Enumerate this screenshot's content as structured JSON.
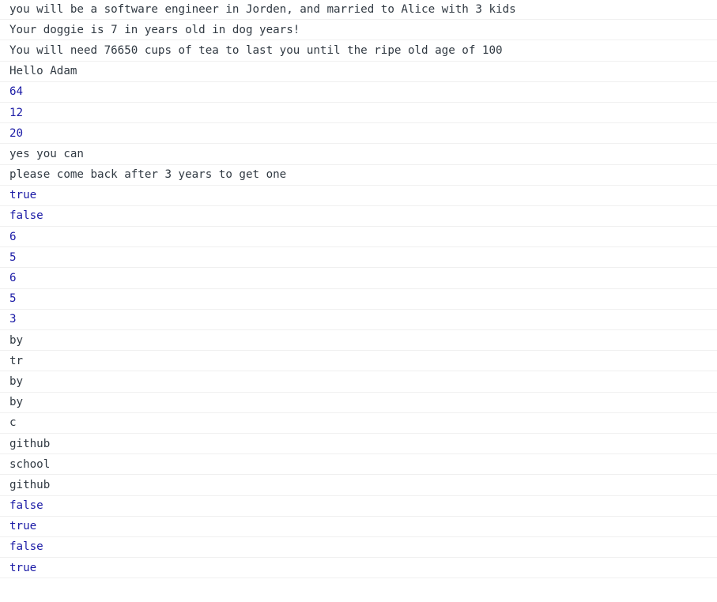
{
  "console": {
    "lines": [
      {
        "text": "you will be a software engineer in Jorden, and married to Alice with 3 kids",
        "type": "string"
      },
      {
        "text": "Your doggie is 7 in years old in dog years!",
        "type": "string"
      },
      {
        "text": "You will need 76650 cups of tea to last you until the ripe old age of 100",
        "type": "string"
      },
      {
        "text": "Hello Adam",
        "type": "string"
      },
      {
        "text": "64",
        "type": "number"
      },
      {
        "text": "12",
        "type": "number"
      },
      {
        "text": "20",
        "type": "number"
      },
      {
        "text": "yes you can",
        "type": "string"
      },
      {
        "text": "please come back after 3 years to get one",
        "type": "string"
      },
      {
        "text": "true",
        "type": "boolean"
      },
      {
        "text": "false",
        "type": "boolean"
      },
      {
        "text": "6",
        "type": "number"
      },
      {
        "text": "5",
        "type": "number"
      },
      {
        "text": "6",
        "type": "number"
      },
      {
        "text": "5",
        "type": "number"
      },
      {
        "text": "3",
        "type": "number"
      },
      {
        "text": "by",
        "type": "string"
      },
      {
        "text": "tr",
        "type": "string"
      },
      {
        "text": "by",
        "type": "string"
      },
      {
        "text": "by",
        "type": "string"
      },
      {
        "text": "c",
        "type": "string"
      },
      {
        "text": "github",
        "type": "string"
      },
      {
        "text": "school",
        "type": "string"
      },
      {
        "text": "github",
        "type": "string"
      },
      {
        "text": "false",
        "type": "boolean"
      },
      {
        "text": "true",
        "type": "boolean"
      },
      {
        "text": "false",
        "type": "boolean"
      },
      {
        "text": "true",
        "type": "boolean"
      }
    ]
  },
  "colors": {
    "string": "#303942",
    "number": "#1a1aa6",
    "boolean": "#1a1aa6",
    "divider": "#f0f0f0",
    "background": "#ffffff"
  }
}
